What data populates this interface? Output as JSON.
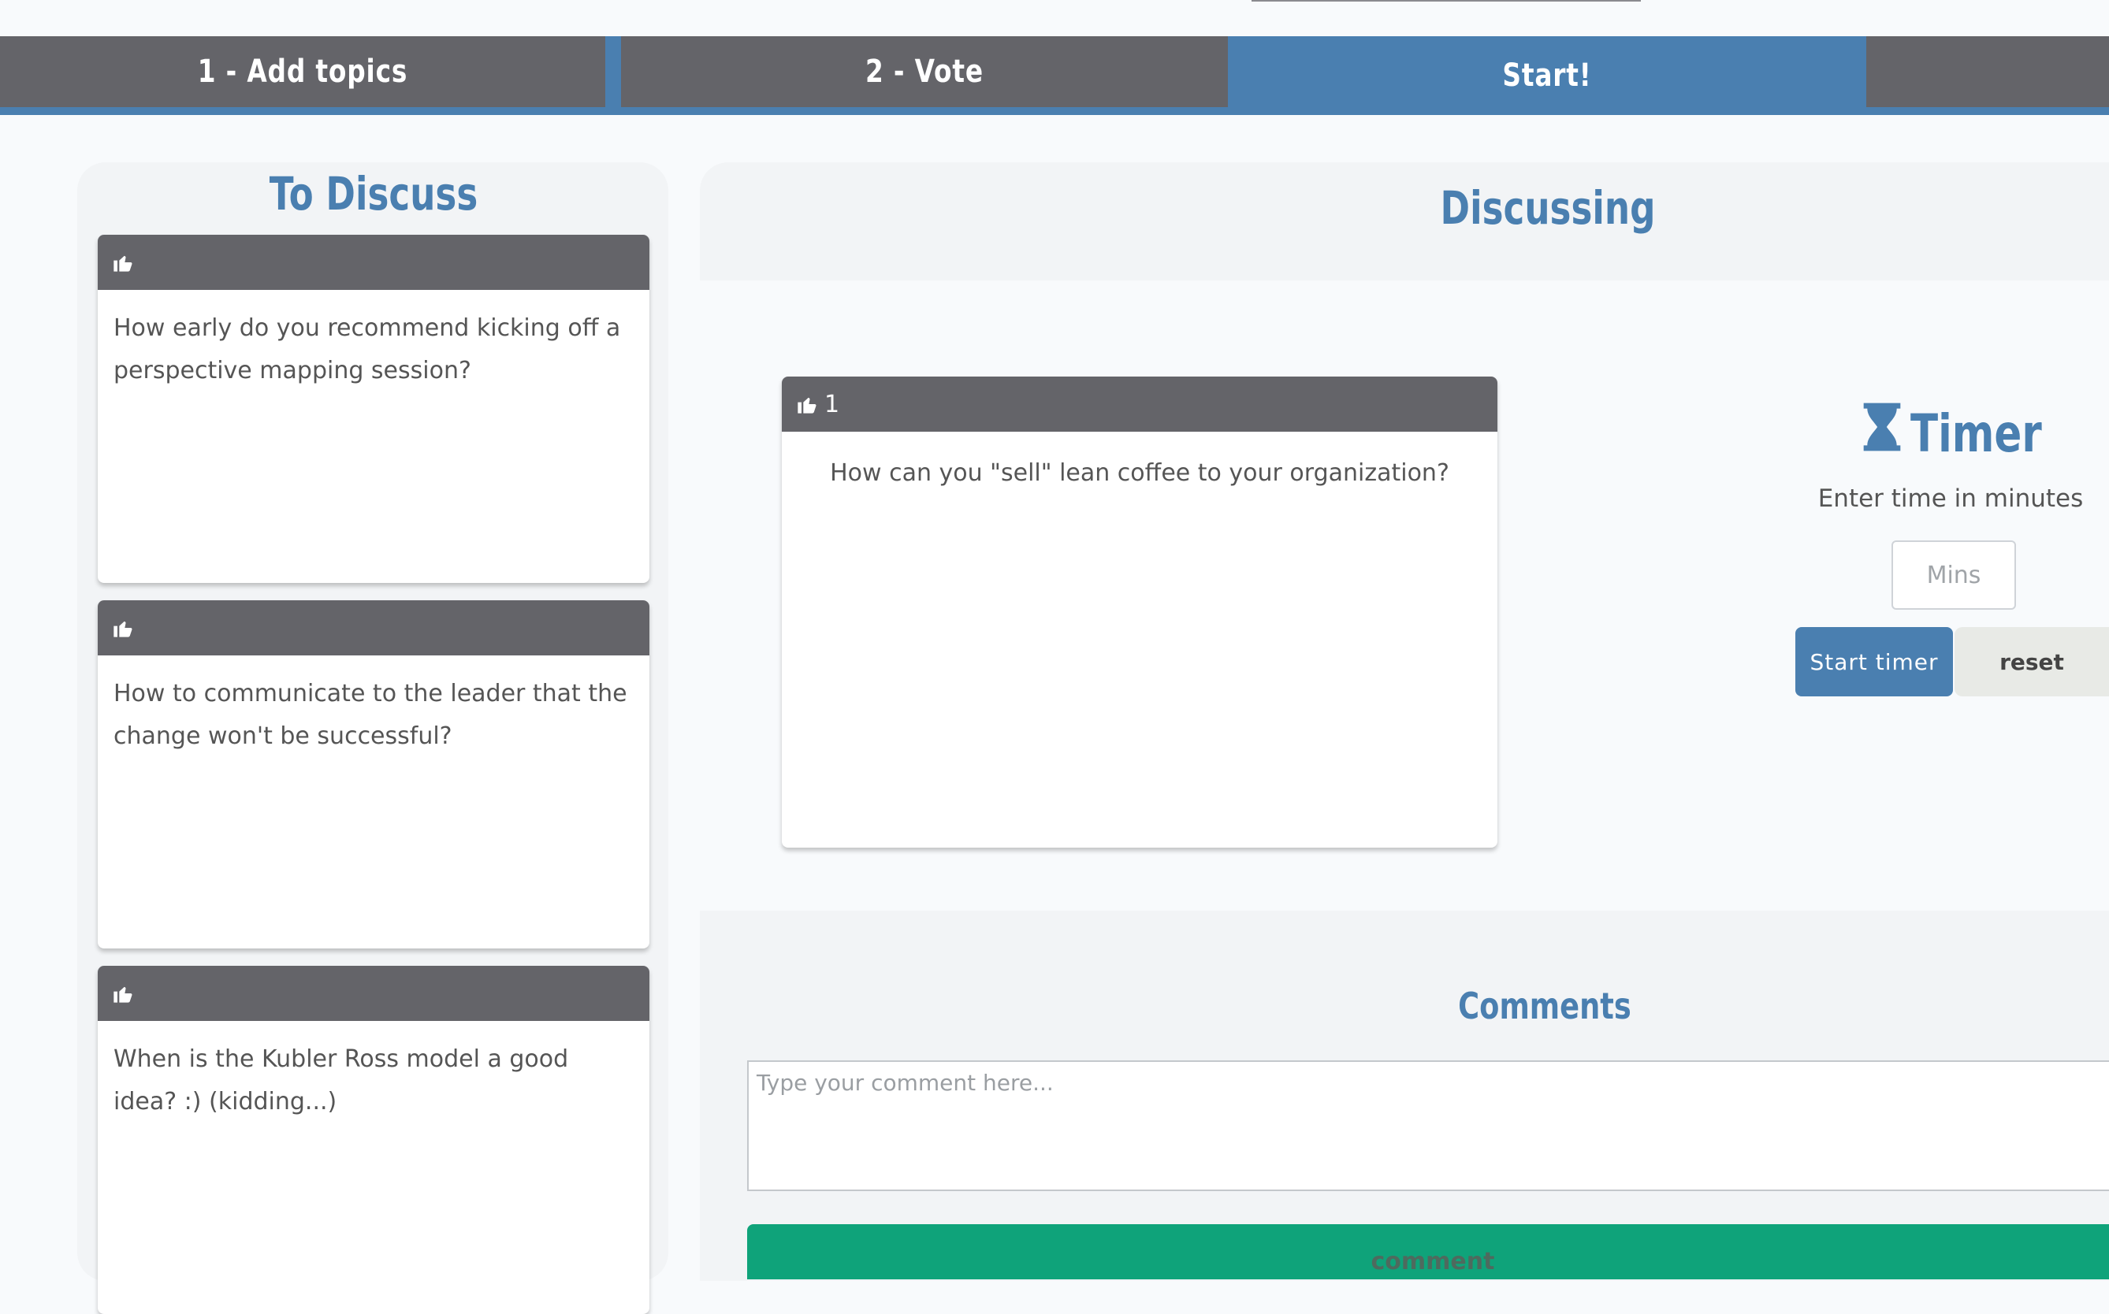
{
  "tabs": [
    {
      "label": "1 - Add topics"
    },
    {
      "label": "2 - Vote"
    },
    {
      "label": "Start!"
    }
  ],
  "to_discuss": {
    "title": "To Discuss",
    "cards": [
      {
        "votes": "",
        "text": "How early do you recommend kicking off a perspective mapping session?"
      },
      {
        "votes": "",
        "text": "How to communicate to the leader that the change won't be successful?"
      },
      {
        "votes": "",
        "text": "When is the Kubler Ross model a good idea? :) (kidding...)"
      }
    ]
  },
  "discussing": {
    "title": "Discussing",
    "card": {
      "votes": "1",
      "text": "How can you \"sell\" lean coffee to your organization?"
    }
  },
  "timer": {
    "title": "Timer",
    "hint": "Enter time in minutes",
    "input_placeholder": "Mins",
    "start_label": "Start timer",
    "reset_label": "reset"
  },
  "comments": {
    "title": "Comments",
    "placeholder": "Type your comment here...",
    "button_label": "comment"
  },
  "colors": {
    "accent": "#4a7fb0",
    "tab_inactive": "#646469",
    "comment_button": "#0fa37a"
  },
  "icons": {
    "vote": "thumbs-up-icon",
    "timer": "hourglass-icon"
  }
}
